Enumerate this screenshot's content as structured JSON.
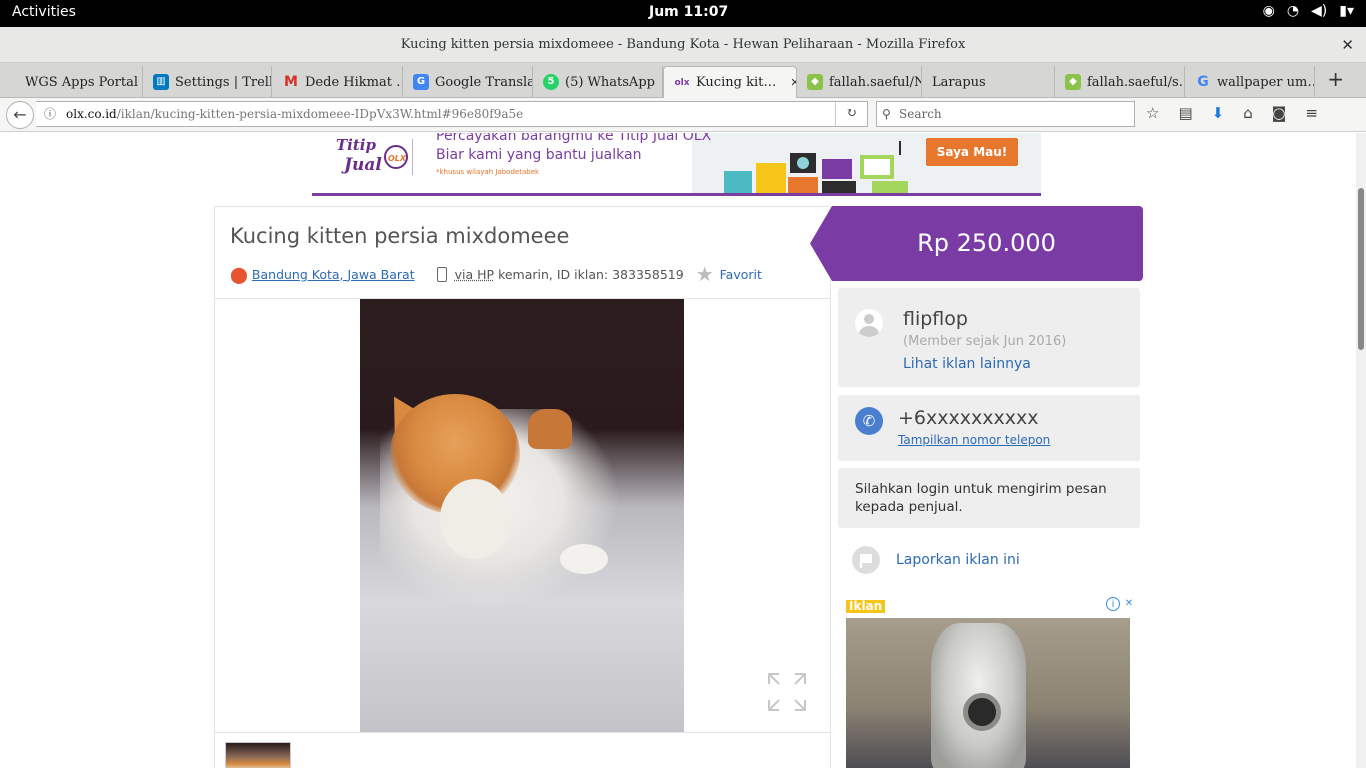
{
  "gnome": {
    "activities": "Activities",
    "clock": "Jum 11:07"
  },
  "window": {
    "title": "Kucing kitten persia mixdomeee - Bandung Kota - Hewan Peliharaan - Mozilla Firefox",
    "close": "✕"
  },
  "tabs": [
    {
      "label": "WGS Apps Portal",
      "icon": "none"
    },
    {
      "label": "Settings | Trello",
      "icon": "trello-icon",
      "color": "#0079bf"
    },
    {
      "label": "Dede Hikmat …",
      "icon": "gmail-icon",
      "color": "#d93025"
    },
    {
      "label": "Google Translate",
      "icon": "translate-icon",
      "color": "#4285f4"
    },
    {
      "label": "(5) WhatsApp",
      "icon": "whatsapp-icon",
      "color": "#25d366"
    },
    {
      "label": "Kucing kit…",
      "icon": "olx-icon",
      "active": true
    },
    {
      "label": "fallah.saeful/N…",
      "icon": "gitlab-icon",
      "color": "#8bc34a"
    },
    {
      "label": "Larapus",
      "icon": "none"
    },
    {
      "label": "fallah.saeful/s…",
      "icon": "gitlab-icon",
      "color": "#8bc34a"
    },
    {
      "label": "wallpaper um…",
      "icon": "google-icon",
      "color": "#4285f4"
    }
  ],
  "nav": {
    "url_domain": "olx.co.id",
    "url_path": "/iklan/kucing-kitten-persia-mixdomeee-IDpVx3W.html#96e80f9a5e",
    "search_placeholder": "Search"
  },
  "banner": {
    "l1": "Percayakan barangmu ke Titip Jual OLX",
    "l2": "Biar kami yang bantu jualkan",
    "l3": "*khusus wilayah Jabodetabek",
    "button": "Saya Mau!",
    "logo": "Titip Jual"
  },
  "listing": {
    "title": "Kucing kitten persia mixdomeee",
    "location": "Bandung Kota, Jawa Barat",
    "via": "via HP",
    "posted": "kemarin, ID iklan: 383358519",
    "favorite": "Favorit"
  },
  "sidebar": {
    "price": "Rp 250.000",
    "seller_name": "flipflop",
    "member_since": "(Member sejak Jun 2016)",
    "more_ads": "Lihat iklan lainnya",
    "phone": "+6xxxxxxxxxx",
    "show_phone": "Tampilkan nomor telepon",
    "login_msg": "Silahkan login untuk mengirim pesan kepada penjual.",
    "report": "Laporkan iklan ini"
  },
  "ad": {
    "label": "Iklan"
  }
}
